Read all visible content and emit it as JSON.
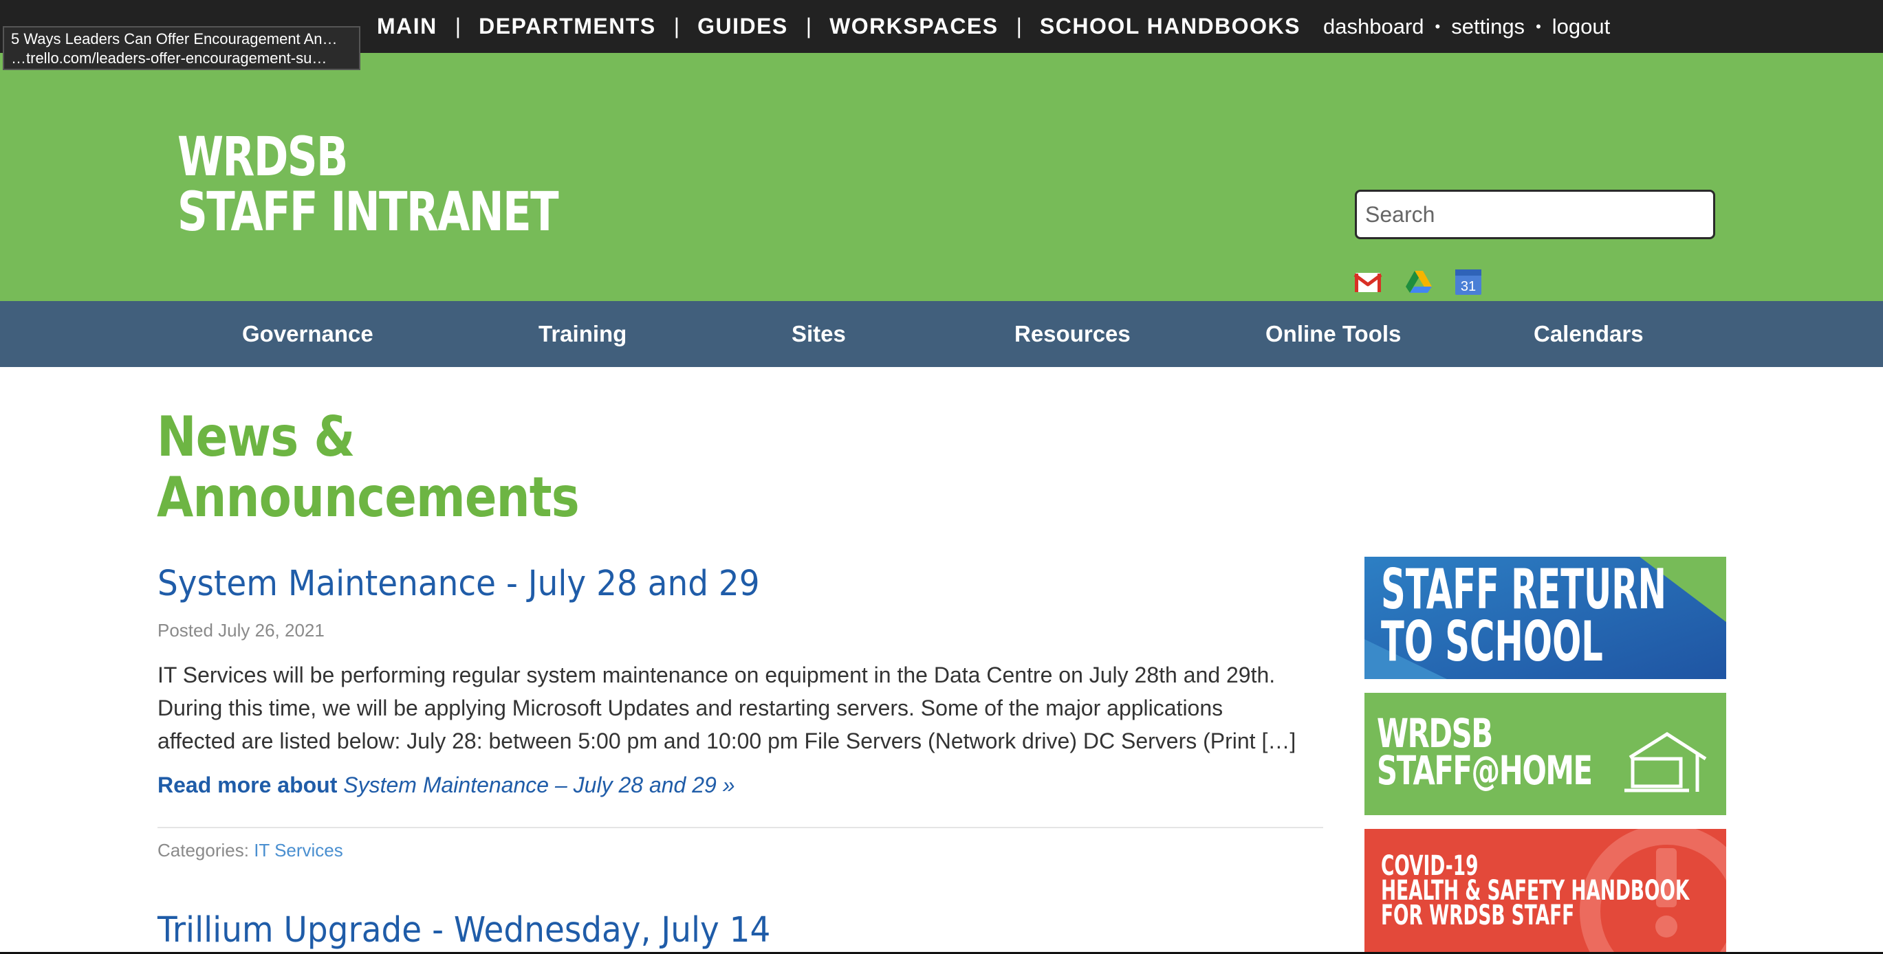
{
  "topnav": {
    "items": [
      "MAIN",
      "DEPARTMENTS",
      "GUIDES",
      "WORKSPACES",
      "SCHOOL HANDBOOKS"
    ],
    "separator": "|"
  },
  "user_links": {
    "dashboard": "dashboard",
    "settings": "settings",
    "logout": "logout",
    "separator": "•"
  },
  "tooltip": {
    "title": "5 Ways Leaders Can Offer Encouragement An…",
    "url": "…trello.com/leaders-offer-encouragement-su…"
  },
  "header": {
    "title_line1": "WRDSB",
    "title_line2": "STAFF INTRANET",
    "search_placeholder": "Search",
    "apps": [
      {
        "icon": "gmail-icon"
      },
      {
        "icon": "google-drive-icon"
      },
      {
        "icon": "google-calendar-icon",
        "text": "31"
      }
    ]
  },
  "mainnav": {
    "items": [
      "Governance",
      "Training",
      "Sites",
      "Resources",
      "Online Tools",
      "Calendars"
    ]
  },
  "content": {
    "heading_line1": "News &",
    "heading_line2": "Announcements",
    "posts": [
      {
        "title": "System Maintenance - July 28 and 29",
        "date": "Posted July 26, 2021",
        "excerpt_lines": [
          "IT Services will be performing regular system maintenance on equipment in the Data Centre on July 28th and 29th.",
          "During this time, we will be applying Microsoft Updates and restarting servers. Some of the major applications",
          "affected are listed below: July 28: between 5:00 pm and 10:00 pm File Servers (Network drive) DC Servers (Print […]"
        ],
        "read_more_label": "Read more about",
        "read_more_title": "System Maintenance – July 28 and 29 »",
        "categories_label": "Categories:",
        "category": "IT Services"
      },
      {
        "title": "Trillium Upgrade - Wednesday, July 14"
      }
    ]
  },
  "sidebar": {
    "banners": [
      {
        "line1": "STAFF RETURN",
        "line2": "TO SCHOOL",
        "colors": [
          "#2a6db5",
          "#77bb58"
        ]
      },
      {
        "line1": "WRDSB",
        "line2": "STAFF@HOME",
        "color": "#77bb58"
      },
      {
        "line1": "COVID-19",
        "line2": "HEALTH & SAFETY HANDBOOK",
        "line3": "FOR WRDSB STAFF",
        "color": "#e3493a"
      }
    ]
  }
}
